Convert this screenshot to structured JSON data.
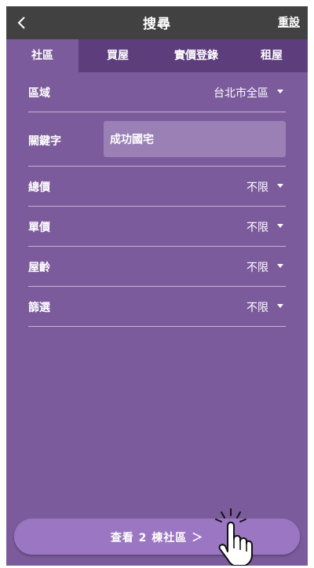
{
  "header": {
    "title": "搜尋",
    "reset_label": "重設",
    "back_icon": "chevron-left-icon"
  },
  "tabs": [
    {
      "label": "社區",
      "active": true
    },
    {
      "label": "買屋",
      "active": false
    },
    {
      "label": "實價登錄",
      "active": false
    },
    {
      "label": "租屋",
      "active": false
    }
  ],
  "filters": {
    "region": {
      "label": "區域",
      "value": "台北市全區"
    },
    "keyword": {
      "label": "關鍵字",
      "value": "成功國宅"
    },
    "total_price": {
      "label": "總價",
      "value": "不限"
    },
    "unit_price": {
      "label": "單價",
      "value": "不限"
    },
    "age": {
      "label": "屋齡",
      "value": "不限"
    },
    "filter": {
      "label": "篩選",
      "value": "不限"
    }
  },
  "cta": {
    "label": "查看 2 棟社區 ＞"
  },
  "colors": {
    "header_bg": "#414141",
    "tabs_bg": "#5e3d7d",
    "panel_bg": "#7c5b9c",
    "button_bg": "#9b77c3"
  }
}
